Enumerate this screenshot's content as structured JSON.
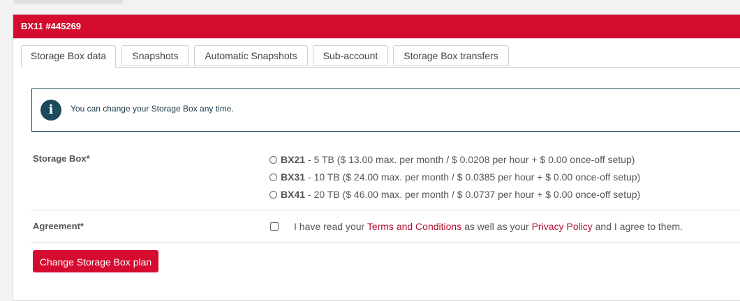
{
  "header": {
    "title": "BX11 #445269"
  },
  "tabs": [
    {
      "label": "Storage Box data",
      "active": true
    },
    {
      "label": "Snapshots"
    },
    {
      "label": "Automatic Snapshots"
    },
    {
      "label": "Sub-account"
    },
    {
      "label": "Storage Box transfers"
    }
  ],
  "info": {
    "icon": "info-icon",
    "text": "You can change your Storage Box any time."
  },
  "storage_box": {
    "label": "Storage Box*",
    "options": [
      {
        "name": "BX21",
        "details": "- 5 TB ($ 13.00 max. per month / $ 0.0208 per hour + $ 0.00 once-off setup)",
        "selected": false
      },
      {
        "name": "BX31",
        "details": "- 10 TB ($ 24.00 max. per month / $ 0.0385 per hour + $ 0.00 once-off setup)",
        "selected": false
      },
      {
        "name": "BX41",
        "details": "- 20 TB ($ 46.00 max. per month / $ 0.0737 per hour + $ 0.00 once-off setup)",
        "selected": false
      }
    ]
  },
  "agreement": {
    "label": "Agreement*",
    "checked": false,
    "text_before": "I have read your ",
    "terms_link": "Terms and Conditions",
    "text_middle": " as well as your ",
    "privacy_link": "Privacy Policy",
    "text_after": " and I agree to them."
  },
  "submit": {
    "label": "Change Storage Box plan"
  },
  "colors": {
    "brand_red": "#d50c2f",
    "info_border": "#1b4a5a",
    "link": "#b5102d"
  }
}
